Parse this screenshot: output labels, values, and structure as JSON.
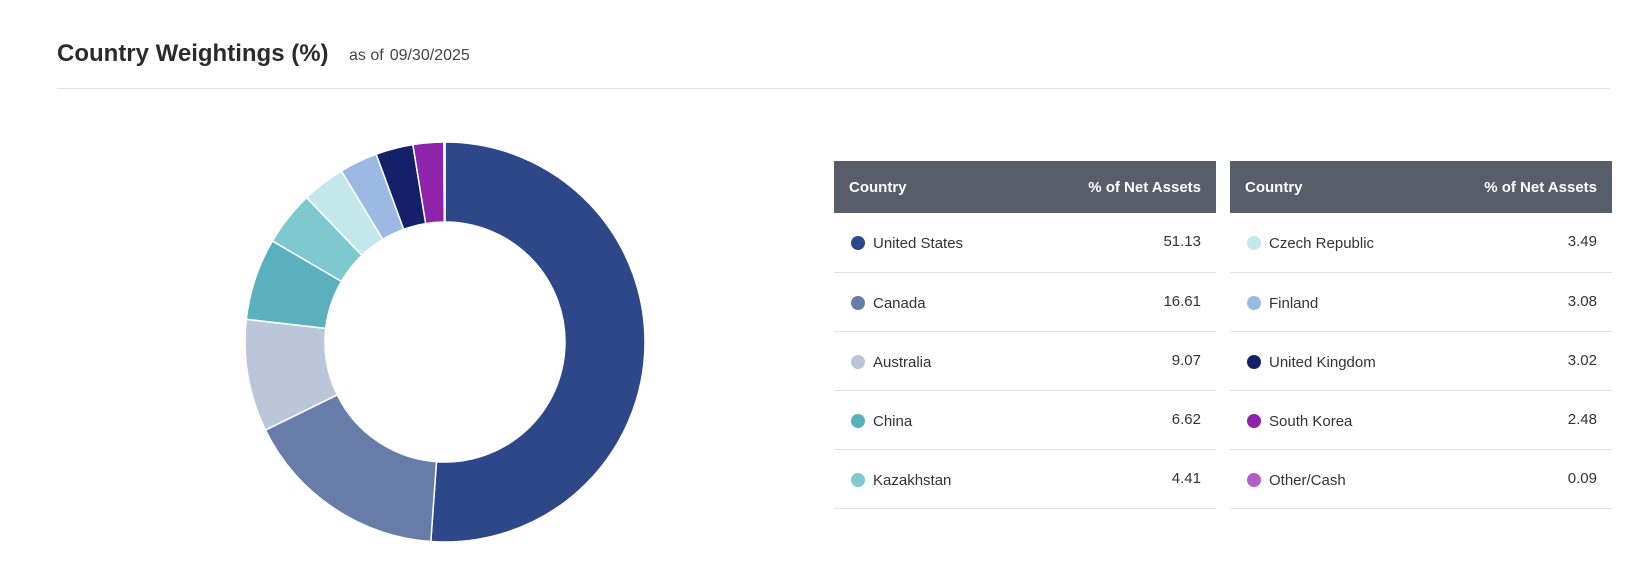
{
  "header": {
    "title": "Country Weightings (%)",
    "as_of_label": "as of",
    "as_of_date": "09/30/2025"
  },
  "table": {
    "col_country": "Country",
    "col_value": "% of Net Assets",
    "left_rows": [
      {
        "country": "United States",
        "value": "51.13",
        "color": "#2d4788"
      },
      {
        "country": "Canada",
        "value": "16.61",
        "color": "#677ca8"
      },
      {
        "country": "Australia",
        "value": "9.07",
        "color": "#bbc6db"
      },
      {
        "country": "China",
        "value": "6.62",
        "color": "#5ab1bd"
      },
      {
        "country": "Kazakhstan",
        "value": "4.41",
        "color": "#7ec8cf"
      }
    ],
    "right_rows": [
      {
        "country": "Czech Republic",
        "value": "3.49",
        "color": "#c3e7ea"
      },
      {
        "country": "Finland",
        "value": "3.08",
        "color": "#9cb9e3"
      },
      {
        "country": "United Kingdom",
        "value": "3.02",
        "color": "#15206b"
      },
      {
        "country": "South Korea",
        "value": "2.48",
        "color": "#8e24aa"
      },
      {
        "country": "Other/Cash",
        "value": "0.09",
        "color": "#b45cc8"
      }
    ]
  },
  "chart_data": {
    "type": "pie",
    "style": "donut",
    "categories": [
      "United States",
      "Canada",
      "Australia",
      "China",
      "Kazakhstan",
      "Czech Republic",
      "Finland",
      "United Kingdom",
      "South Korea",
      "Other/Cash"
    ],
    "values": [
      51.13,
      16.61,
      9.07,
      6.62,
      4.41,
      3.49,
      3.08,
      3.02,
      2.48,
      0.09
    ],
    "colors": [
      "#2d4788",
      "#677ca8",
      "#bbc6db",
      "#5ab1bd",
      "#7ec8cf",
      "#c3e7ea",
      "#9cb9e3",
      "#15206b",
      "#8e24aa",
      "#b45cc8"
    ],
    "start_angle_deg": 0,
    "direction": "clockwise"
  }
}
